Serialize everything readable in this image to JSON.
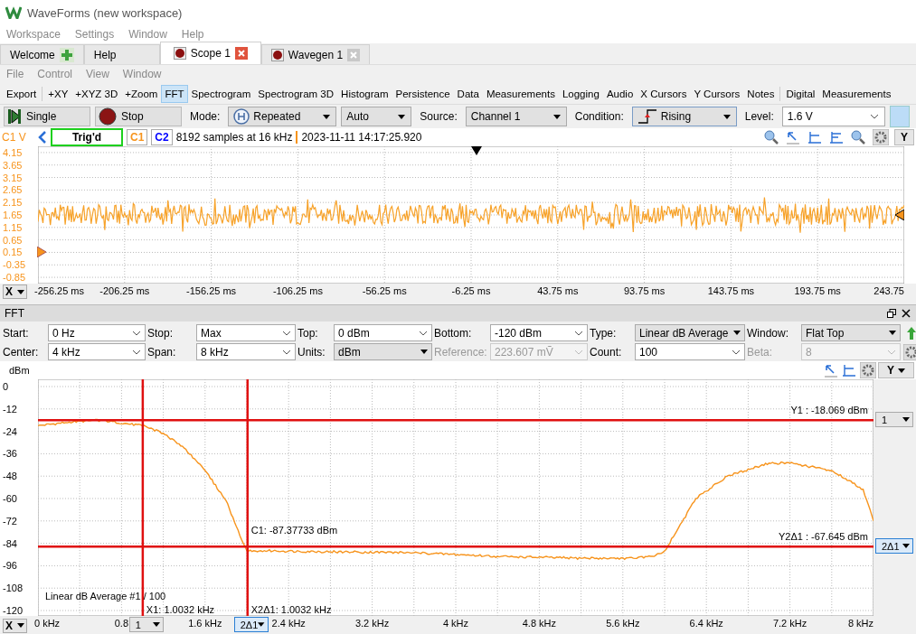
{
  "window": {
    "title": "WaveForms (new workspace)"
  },
  "menu": [
    "Workspace",
    "Settings",
    "Window",
    "Help"
  ],
  "tabs": [
    {
      "label": "Welcome",
      "kind": "home",
      "selected": false
    },
    {
      "label": "Help",
      "kind": "plain",
      "selected": false
    },
    {
      "label": "Scope 1",
      "kind": "instrument",
      "selected": true
    },
    {
      "label": "Wavegen 1",
      "kind": "instrument",
      "selected": false
    }
  ],
  "submenu": [
    "File",
    "Control",
    "View",
    "Window"
  ],
  "toolbar": [
    {
      "label": "Export",
      "selected": false,
      "separator_after": true
    },
    {
      "label": "+XY",
      "selected": false,
      "separator_after": false
    },
    {
      "label": "+XYZ 3D",
      "selected": false,
      "separator_after": false
    },
    {
      "label": "+Zoom",
      "selected": false,
      "separator_after": false
    },
    {
      "label": "FFT",
      "selected": true,
      "separator_after": false
    },
    {
      "label": "Spectrogram",
      "selected": false,
      "separator_after": false
    },
    {
      "label": "Spectrogram 3D",
      "selected": false,
      "separator_after": false
    },
    {
      "label": "Histogram",
      "selected": false,
      "separator_after": false
    },
    {
      "label": "Persistence",
      "selected": false,
      "separator_after": false
    },
    {
      "label": "Data",
      "selected": false,
      "separator_after": false
    },
    {
      "label": "Measurements",
      "selected": false,
      "separator_after": false
    },
    {
      "label": "Logging",
      "selected": false,
      "separator_after": false
    },
    {
      "label": "Audio",
      "selected": false,
      "separator_after": false
    },
    {
      "label": "X Cursors",
      "selected": false,
      "separator_after": false
    },
    {
      "label": "Y Cursors",
      "selected": false,
      "separator_after": false
    },
    {
      "label": "Notes",
      "selected": false,
      "separator_after": true
    },
    {
      "label": "Digital",
      "selected": false,
      "separator_after": false
    },
    {
      "label": "Measurements",
      "selected": false,
      "separator_after": false
    }
  ],
  "run_bar": [
    {
      "kind": "single",
      "text": "Single"
    },
    {
      "kind": "stop",
      "text": "Stop"
    },
    {
      "kind": "label",
      "text": "Mode:"
    },
    {
      "kind": "repeat-select",
      "text": "Repeated"
    },
    {
      "kind": "select",
      "text": "Auto"
    },
    {
      "kind": "label",
      "text": "Source:"
    },
    {
      "kind": "select",
      "text": "Channel 1"
    },
    {
      "kind": "label",
      "text": "Condition:"
    },
    {
      "kind": "edge-select",
      "text": "Rising"
    },
    {
      "kind": "label",
      "text": "Level:"
    },
    {
      "kind": "combo",
      "text": "1.6 V"
    }
  ],
  "scope": {
    "unit_label": "C1 V",
    "status": "Trig'd",
    "channels": [
      {
        "label": "C1",
        "color": "#f7941d"
      },
      {
        "label": "C2",
        "color": "#0000ff"
      }
    ],
    "info": "8192 samples at 16 kHz",
    "timestamp": "2023-11-11 14:17:25.920",
    "y_button": "Y",
    "x_button": "X",
    "y_ticks": [
      "4.15",
      "3.65",
      "3.15",
      "2.65",
      "2.15",
      "1.65",
      "1.15",
      "0.65",
      "0.15",
      "-0.35",
      "-0.85"
    ],
    "x_ticks": [
      "-256.25 ms",
      "-206.25 ms",
      "-156.25 ms",
      "-106.25 ms",
      "-56.25 ms",
      "-6.25 ms",
      "43.75 ms",
      "93.75 ms",
      "143.75 ms",
      "193.75 ms",
      "243.75"
    ]
  },
  "fft": {
    "title": "FFT",
    "param_rows": [
      [
        {
          "label": "Start:",
          "value": "0 Hz",
          "kind": "combo"
        },
        {
          "label": "Stop:",
          "value": "Max",
          "kind": "combo"
        },
        {
          "label": "Top:",
          "value": "0 dBm",
          "kind": "combo"
        },
        {
          "label": "Bottom:",
          "value": "-120 dBm",
          "kind": "combo"
        },
        {
          "label": "Type:",
          "value": "Linear dB Average",
          "kind": "select"
        },
        {
          "label": "Window:",
          "value": "Flat Top",
          "kind": "select"
        }
      ],
      [
        {
          "label": "Center:",
          "value": "4 kHz",
          "kind": "combo"
        },
        {
          "label": "Span:",
          "value": "8 kHz",
          "kind": "combo"
        },
        {
          "label": "Units:",
          "value": "dBm",
          "kind": "select"
        },
        {
          "label": "Reference:",
          "value": "223.607 mṼ",
          "kind": "disabled"
        },
        {
          "label": "Count:",
          "value": "100",
          "kind": "combo"
        },
        {
          "label": "Beta:",
          "value": "8",
          "kind": "disabled"
        }
      ]
    ],
    "y_button": "Y",
    "x_button": "X",
    "legend": "Linear dB Average #1 / 100",
    "y_cursor_tags": [
      {
        "label": "1",
        "selected": false
      },
      {
        "label": "2Δ1",
        "selected": true
      }
    ],
    "x_cursor_tags": [
      {
        "label": "1",
        "selected": false
      },
      {
        "label": "2Δ1",
        "selected": true
      }
    ],
    "chart_data": {
      "type": "line",
      "ylabel": "dBm",
      "xlim": [
        0,
        8
      ],
      "ylim": [
        -120,
        0
      ],
      "grid": true,
      "xticks": [
        {
          "value": 0,
          "label": "0 kHz"
        },
        {
          "value": 0.8,
          "label": "0.8"
        },
        {
          "value": 1.6,
          "label": "1.6 kHz"
        },
        {
          "value": 2.4,
          "label": "2.4 kHz"
        },
        {
          "value": 3.2,
          "label": "3.2 kHz"
        },
        {
          "value": 4,
          "label": "4 kHz"
        },
        {
          "value": 4.8,
          "label": "4.8 kHz"
        },
        {
          "value": 5.6,
          "label": "5.6 kHz"
        },
        {
          "value": 6.4,
          "label": "6.4 kHz"
        },
        {
          "value": 7.2,
          "label": "7.2 kHz"
        },
        {
          "value": 8,
          "label": "8 kHz"
        }
      ],
      "yticks": [
        0,
        -12,
        -24,
        -36,
        -48,
        -60,
        -72,
        -84,
        -96,
        -108,
        -120
      ],
      "x": [
        0,
        0.3,
        0.6,
        1.0,
        1.2,
        1.4,
        1.6,
        1.8,
        1.9,
        2.0,
        2.2,
        2.8,
        3.6,
        4.4,
        5.2,
        5.7,
        5.9,
        6.0,
        6.1,
        6.3,
        6.6,
        7.0,
        7.2,
        7.6,
        7.9,
        8.0
      ],
      "series": [
        {
          "color": "#f7941d",
          "values": [
            -21,
            -19,
            -18,
            -21,
            -25,
            -33,
            -45,
            -61,
            -75,
            -88,
            -88,
            -88.5,
            -89,
            -91,
            -92,
            -92,
            -91,
            -88,
            -79,
            -60,
            -48,
            -41,
            -41,
            -45,
            -55,
            -72
          ]
        }
      ],
      "ref_lines": [
        {
          "axis": "y",
          "value": -18.069,
          "label": "Y1 : -18.069 dBm"
        },
        {
          "axis": "y",
          "value": -85.714
        },
        {
          "axis": "x",
          "value": 1.0032,
          "label": "X1: 1.0032 kHz"
        },
        {
          "axis": "x",
          "value": 2.0064,
          "label": "X2Δ1: 1.0032 kHz"
        }
      ],
      "annotations": [
        {
          "x": 2.0064,
          "y": -87.37733,
          "text": "C1: -87.37733 dBm"
        },
        "Y2Δ1 : -67.645 dBm"
      ]
    }
  }
}
